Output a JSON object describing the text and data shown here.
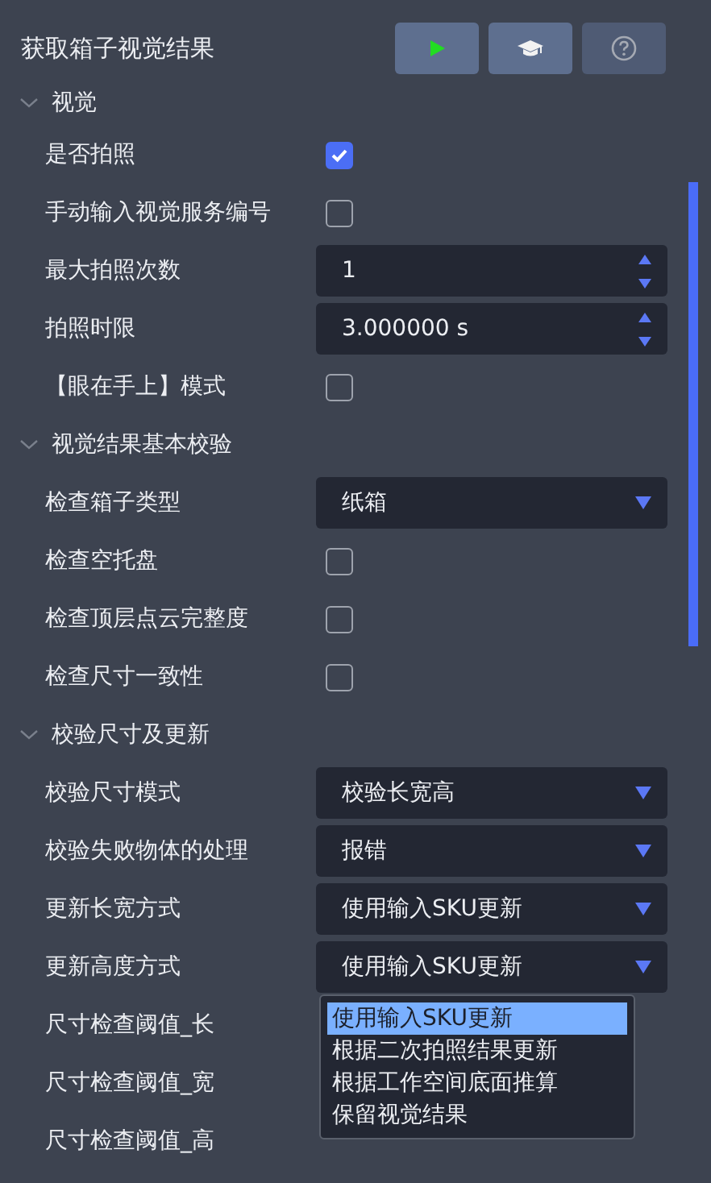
{
  "title": "获取箱子视觉结果",
  "toolbar": [
    {
      "kind": "run",
      "disabled": false
    },
    {
      "kind": "course",
      "disabled": false
    },
    {
      "kind": "help",
      "disabled": true
    }
  ],
  "rows": [
    {
      "kind": "section",
      "label": "视觉",
      "expanded": true
    },
    {
      "kind": "checkbox",
      "label": "是否拍照",
      "checked": true
    },
    {
      "kind": "checkbox",
      "label": "手动输入视觉服务编号",
      "checked": false
    },
    {
      "kind": "spin",
      "label": "最大拍照次数",
      "value": "1"
    },
    {
      "kind": "spin",
      "label": "拍照时限",
      "value": "3.000000 s"
    },
    {
      "kind": "checkbox",
      "label": "【眼在手上】模式",
      "checked": false
    },
    {
      "kind": "section",
      "label": "视觉结果基本校验",
      "expanded": true
    },
    {
      "kind": "select",
      "label": "检查箱子类型",
      "value": "纸箱"
    },
    {
      "kind": "checkbox",
      "label": "检查空托盘",
      "checked": false
    },
    {
      "kind": "checkbox",
      "label": "检查顶层点云完整度",
      "checked": false
    },
    {
      "kind": "checkbox",
      "label": "检查尺寸一致性",
      "checked": false
    },
    {
      "kind": "section",
      "label": "校验尺寸及更新",
      "expanded": true
    },
    {
      "kind": "select",
      "label": "校验尺寸模式",
      "value": "校验长宽高"
    },
    {
      "kind": "select",
      "label": "校验失败物体的处理",
      "value": "报错"
    },
    {
      "kind": "select",
      "label": "更新长宽方式",
      "value": "使用输入SKU更新"
    },
    {
      "kind": "select",
      "label": "更新高度方式",
      "value": "使用输入SKU更新",
      "menu": [
        {
          "label": "使用输入SKU更新",
          "selected": true
        },
        {
          "label": "根据二次拍照结果更新",
          "selected": false
        },
        {
          "label": "根据工作空间底面推算",
          "selected": false
        },
        {
          "label": "保留视觉结果",
          "selected": false
        }
      ]
    },
    {
      "kind": "plain",
      "label": "尺寸检查阈值_长"
    },
    {
      "kind": "plain",
      "label": "尺寸检查阈值_宽"
    },
    {
      "kind": "plain",
      "label": "尺寸检查阈值_高"
    }
  ]
}
